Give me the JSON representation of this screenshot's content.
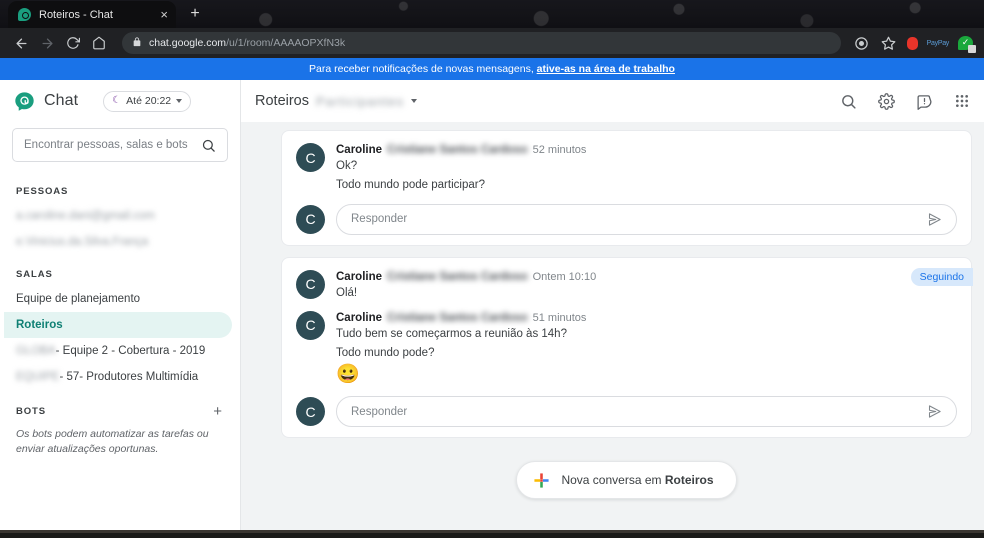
{
  "browser": {
    "tab": {
      "title": "Roteiros - Chat",
      "favicon": "chat-favicon",
      "close_label": "×"
    },
    "new_tab_label": "+",
    "nav": {
      "back": "←",
      "forward": "→",
      "reload": "⟳",
      "home": "⌂"
    },
    "omnibox": {
      "lock": "lock-icon",
      "domain": "chat.google.com",
      "path": "/u/1/room/AAAAOPXfN3k"
    },
    "extensions": {
      "profile": "circle-icon",
      "bookmark": "star-icon",
      "ext1": "pocket-icon",
      "ext2": "PayPay",
      "ext3": "checkmark-leaf-icon"
    }
  },
  "notification": {
    "text": "Para receber notificações de novas mensagens, ",
    "link": "ative-as na área de trabalho"
  },
  "sidebar": {
    "brand": "Chat",
    "status": {
      "icon": "moon-icon",
      "label": "Até 20:22"
    },
    "search": {
      "placeholder": "Encontrar pessoas, salas e bots",
      "value": ""
    },
    "people": {
      "title": "PESSOAS",
      "items": [
        {
          "label": "a.caroline.dani@gmail.com",
          "blurred": true
        },
        {
          "label": "e.Vinicius.da.Silva.França",
          "blurred": true
        }
      ]
    },
    "rooms": {
      "title": "SALAS",
      "items": [
        {
          "label": "Equipe de planejamento",
          "active": false,
          "blurred": false,
          "blur_prefix": ""
        },
        {
          "label": "Roteiros",
          "active": true,
          "blurred": false,
          "blur_prefix": ""
        },
        {
          "label": " - Equipe 2 - Cobertura - 2019",
          "active": false,
          "blurred": false,
          "blur_prefix": "GLOBA"
        },
        {
          "label": " - 57- Produtores Multimídia",
          "active": false,
          "blurred": false,
          "blur_prefix": "EQUIPE"
        }
      ]
    },
    "bots": {
      "title": "BOTS",
      "add_label": "+",
      "note": "Os bots podem automatizar as tarefas ou enviar atualizações oportunas."
    }
  },
  "main": {
    "header": {
      "room": "Roteiros",
      "room_sub": "Participantes",
      "dropdown": "chevron-down-icon",
      "icons": [
        "search-icon",
        "gear-icon",
        "feedback-icon",
        "apps-grid-icon"
      ]
    },
    "threads": [
      {
        "follow_badge": null,
        "messages": [
          {
            "avatar": "C",
            "sender": "Caroline",
            "sender_blur": "Cristiane Santos Cardoso",
            "timestamp": "52 minutos",
            "lines": [
              "Ok?",
              "Todo mundo pode participar?"
            ],
            "emoji": null
          }
        ],
        "reply": {
          "avatar": "C",
          "placeholder": "Responder",
          "value": "",
          "send_icon": "send-icon"
        }
      },
      {
        "follow_badge": "Seguindo",
        "messages": [
          {
            "avatar": "C",
            "sender": "Caroline",
            "sender_blur": "Cristiane Santos Cardoso",
            "timestamp": "Ontem 10:10",
            "lines": [
              "Olá!"
            ],
            "emoji": null
          },
          {
            "avatar": "C",
            "sender": "Caroline",
            "sender_blur": "Cristiane Santos Cardoso",
            "timestamp": "51 minutos",
            "lines": [
              "Tudo bem se começarmos a reunião às 14h?",
              "Todo mundo pode?"
            ],
            "emoji": "😀"
          }
        ],
        "reply": {
          "avatar": "C",
          "placeholder": "Responder",
          "value": "",
          "send_icon": "send-icon"
        }
      }
    ],
    "new_conversation": {
      "prefix": "Nova conversa em ",
      "room": "Roteiros",
      "icon": "google-plus-icon"
    }
  },
  "colors": {
    "accent_blue": "#1a73e8",
    "chat_green": "#1a9e7f",
    "active_room_bg": "#e4f4f2",
    "active_room_text": "#0f8074",
    "avatar_bg": "#2e4c55",
    "follow_badge_bg": "#d7e8fb",
    "page_bg": "#f1f3f4"
  }
}
